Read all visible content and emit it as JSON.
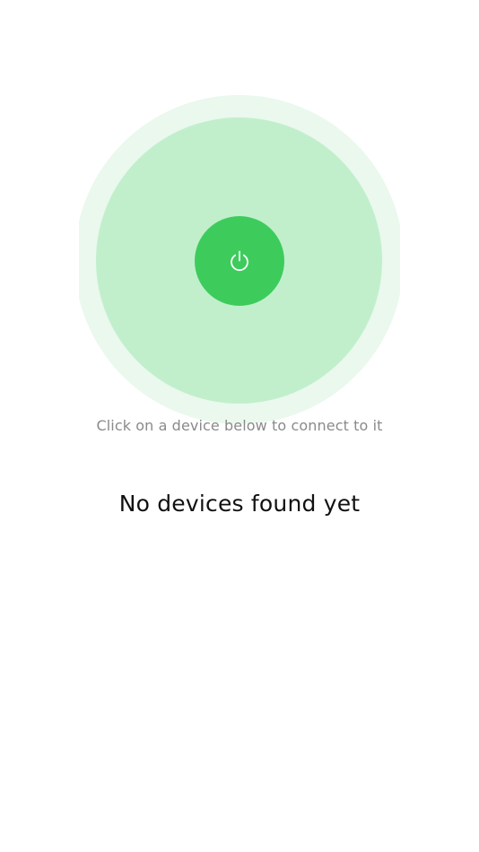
{
  "scanner": {
    "power_icon": "power-icon",
    "colors": {
      "outer_ring": "#eaf8ed",
      "inner_ring": "#c1efcc",
      "button": "#3dcc5c",
      "icon": "#ffffff"
    }
  },
  "hint_text": "Click on a device below to connect to it",
  "empty_state_text": "No devices found yet"
}
